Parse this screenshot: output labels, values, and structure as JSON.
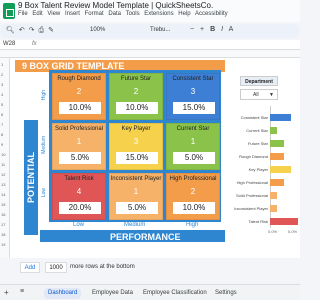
{
  "app": {
    "title": "9 Box Talent Review Model Template | QuickSheetsCo.",
    "menu": [
      "File",
      "Edit",
      "View",
      "Insert",
      "Format",
      "Data",
      "Tools",
      "Extensions",
      "Help",
      "Accessibility"
    ]
  },
  "toolbar": {
    "zoom": "100%",
    "font": "Trebu..."
  },
  "formula_bar": {
    "cell_ref": "W28",
    "fx": "fx"
  },
  "sheet": {
    "header_title": "9 BOX GRID TEMPLATE",
    "potential_label": "POTENTIAL",
    "performance_label": "PERFORMANCE",
    "y_levels": [
      "High",
      "Medium",
      "Low"
    ],
    "x_levels": [
      "Low",
      "Medium",
      "High"
    ],
    "boxes": [
      {
        "name": "Rough Diamond",
        "num": "2",
        "pct": "10.0%",
        "color": "#f39c4a"
      },
      {
        "name": "Future Star",
        "num": "2",
        "pct": "10.0%",
        "color": "#8bc34a"
      },
      {
        "name": "Consistent Star",
        "num": "3",
        "pct": "15.0%",
        "color": "#3d7fd4"
      },
      {
        "name": "Solid Professional",
        "num": "1",
        "pct": "5.0%",
        "color": "#f7b26a"
      },
      {
        "name": "Key Player",
        "num": "3",
        "pct": "15.0%",
        "color": "#f6d14b"
      },
      {
        "name": "Current Star",
        "num": "1",
        "pct": "5.0%",
        "color": "#8bc34a"
      },
      {
        "name": "Talent Risk",
        "num": "4",
        "pct": "20.0%",
        "color": "#e05656"
      },
      {
        "name": "Inconsistent Player",
        "num": "1",
        "pct": "5.0%",
        "color": "#f7b26a"
      },
      {
        "name": "High Professional",
        "num": "2",
        "pct": "10.0%",
        "color": "#f39c4a"
      }
    ]
  },
  "panel": {
    "dept_label": "Department",
    "dept_value": "All",
    "bars": [
      {
        "label": "Consistent Star",
        "value": 0.15,
        "color": "#3d7fd4"
      },
      {
        "label": "Current Star",
        "value": 0.05,
        "color": "#8bc34a"
      },
      {
        "label": "Future Star",
        "value": 0.1,
        "color": "#8bc34a"
      },
      {
        "label": "Rough Diamond",
        "value": 0.1,
        "color": "#f39c4a"
      },
      {
        "label": "Key Player",
        "value": 0.15,
        "color": "#f6d14b"
      },
      {
        "label": "High Professional",
        "value": 0.1,
        "color": "#f39c4a"
      },
      {
        "label": "Solid Professional",
        "value": 0.05,
        "color": "#f7b26a"
      },
      {
        "label": "Inconsistent Player",
        "value": 0.05,
        "color": "#f7b26a"
      },
      {
        "label": "Talent Risk",
        "value": 0.2,
        "color": "#e05656"
      }
    ],
    "ticks": [
      "0.0%",
      "5.0%"
    ]
  },
  "add_rows": {
    "button": "Add",
    "count": "1000",
    "text": "more rows at the bottom"
  },
  "tabs": [
    {
      "label": "Dashboard",
      "active": true
    },
    {
      "label": "Employee Data",
      "active": false
    },
    {
      "label": "Employee Classification",
      "active": false
    },
    {
      "label": "Settings",
      "active": false
    }
  ]
}
